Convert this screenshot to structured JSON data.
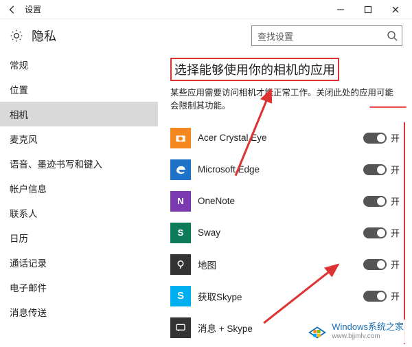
{
  "window": {
    "title": "设置"
  },
  "page": {
    "title": "隐私"
  },
  "search": {
    "placeholder": "查找设置"
  },
  "sidebar": {
    "items": [
      {
        "label": "常规"
      },
      {
        "label": "位置"
      },
      {
        "label": "相机"
      },
      {
        "label": "麦克风"
      },
      {
        "label": "语音、墨迹书写和键入"
      },
      {
        "label": "帐户信息"
      },
      {
        "label": "联系人"
      },
      {
        "label": "日历"
      },
      {
        "label": "通话记录"
      },
      {
        "label": "电子邮件"
      },
      {
        "label": "消息传送"
      }
    ],
    "active_index": 2
  },
  "section": {
    "title": "选择能够使用你的相机的应用",
    "desc": "某些应用需要访问相机才能正常工作。关闭此处的应用可能会限制其功能。"
  },
  "apps": [
    {
      "icon": "camera",
      "bg": "#f5871f",
      "label": "Acer Crystal Eye",
      "state": "开"
    },
    {
      "icon": "edge",
      "bg": "#1e73c9",
      "label": "Microsoft Edge",
      "state": "开"
    },
    {
      "icon": "onenote",
      "bg": "#7b3ab0",
      "label": "OneNote",
      "state": "开"
    },
    {
      "icon": "sway",
      "bg": "#0b7b5a",
      "label": "Sway",
      "state": "开"
    },
    {
      "icon": "maps",
      "bg": "#333333",
      "label": "地图",
      "state": "开"
    },
    {
      "icon": "skype",
      "bg": "#00aff0",
      "label": "获取Skype",
      "state": "开"
    },
    {
      "icon": "msg",
      "bg": "#333333",
      "label": "消息 + Skype",
      "state": ""
    }
  ],
  "watermark": {
    "t1": "Windows系统之家",
    "t2": "www.bjjmlv.com"
  }
}
